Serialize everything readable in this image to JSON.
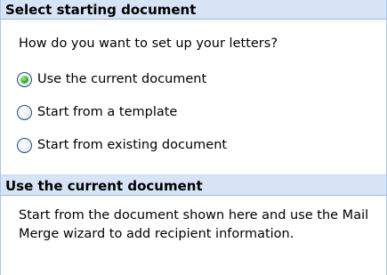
{
  "starting_document": {
    "header": "Select starting document",
    "prompt": "How do you want to set up your letters?",
    "options": [
      {
        "label": "Use the current document",
        "selected": true
      },
      {
        "label": "Start from a template",
        "selected": false
      },
      {
        "label": "Start from existing document",
        "selected": false
      }
    ]
  },
  "current_document_info": {
    "header": "Use the current document",
    "description": "Start from the document shown here and use the Mail Merge wizard to add recipient information."
  },
  "colors": {
    "header_background": "#d6e4f6",
    "pane_border": "#a9c4ea",
    "radio_selected": "#3db427"
  }
}
